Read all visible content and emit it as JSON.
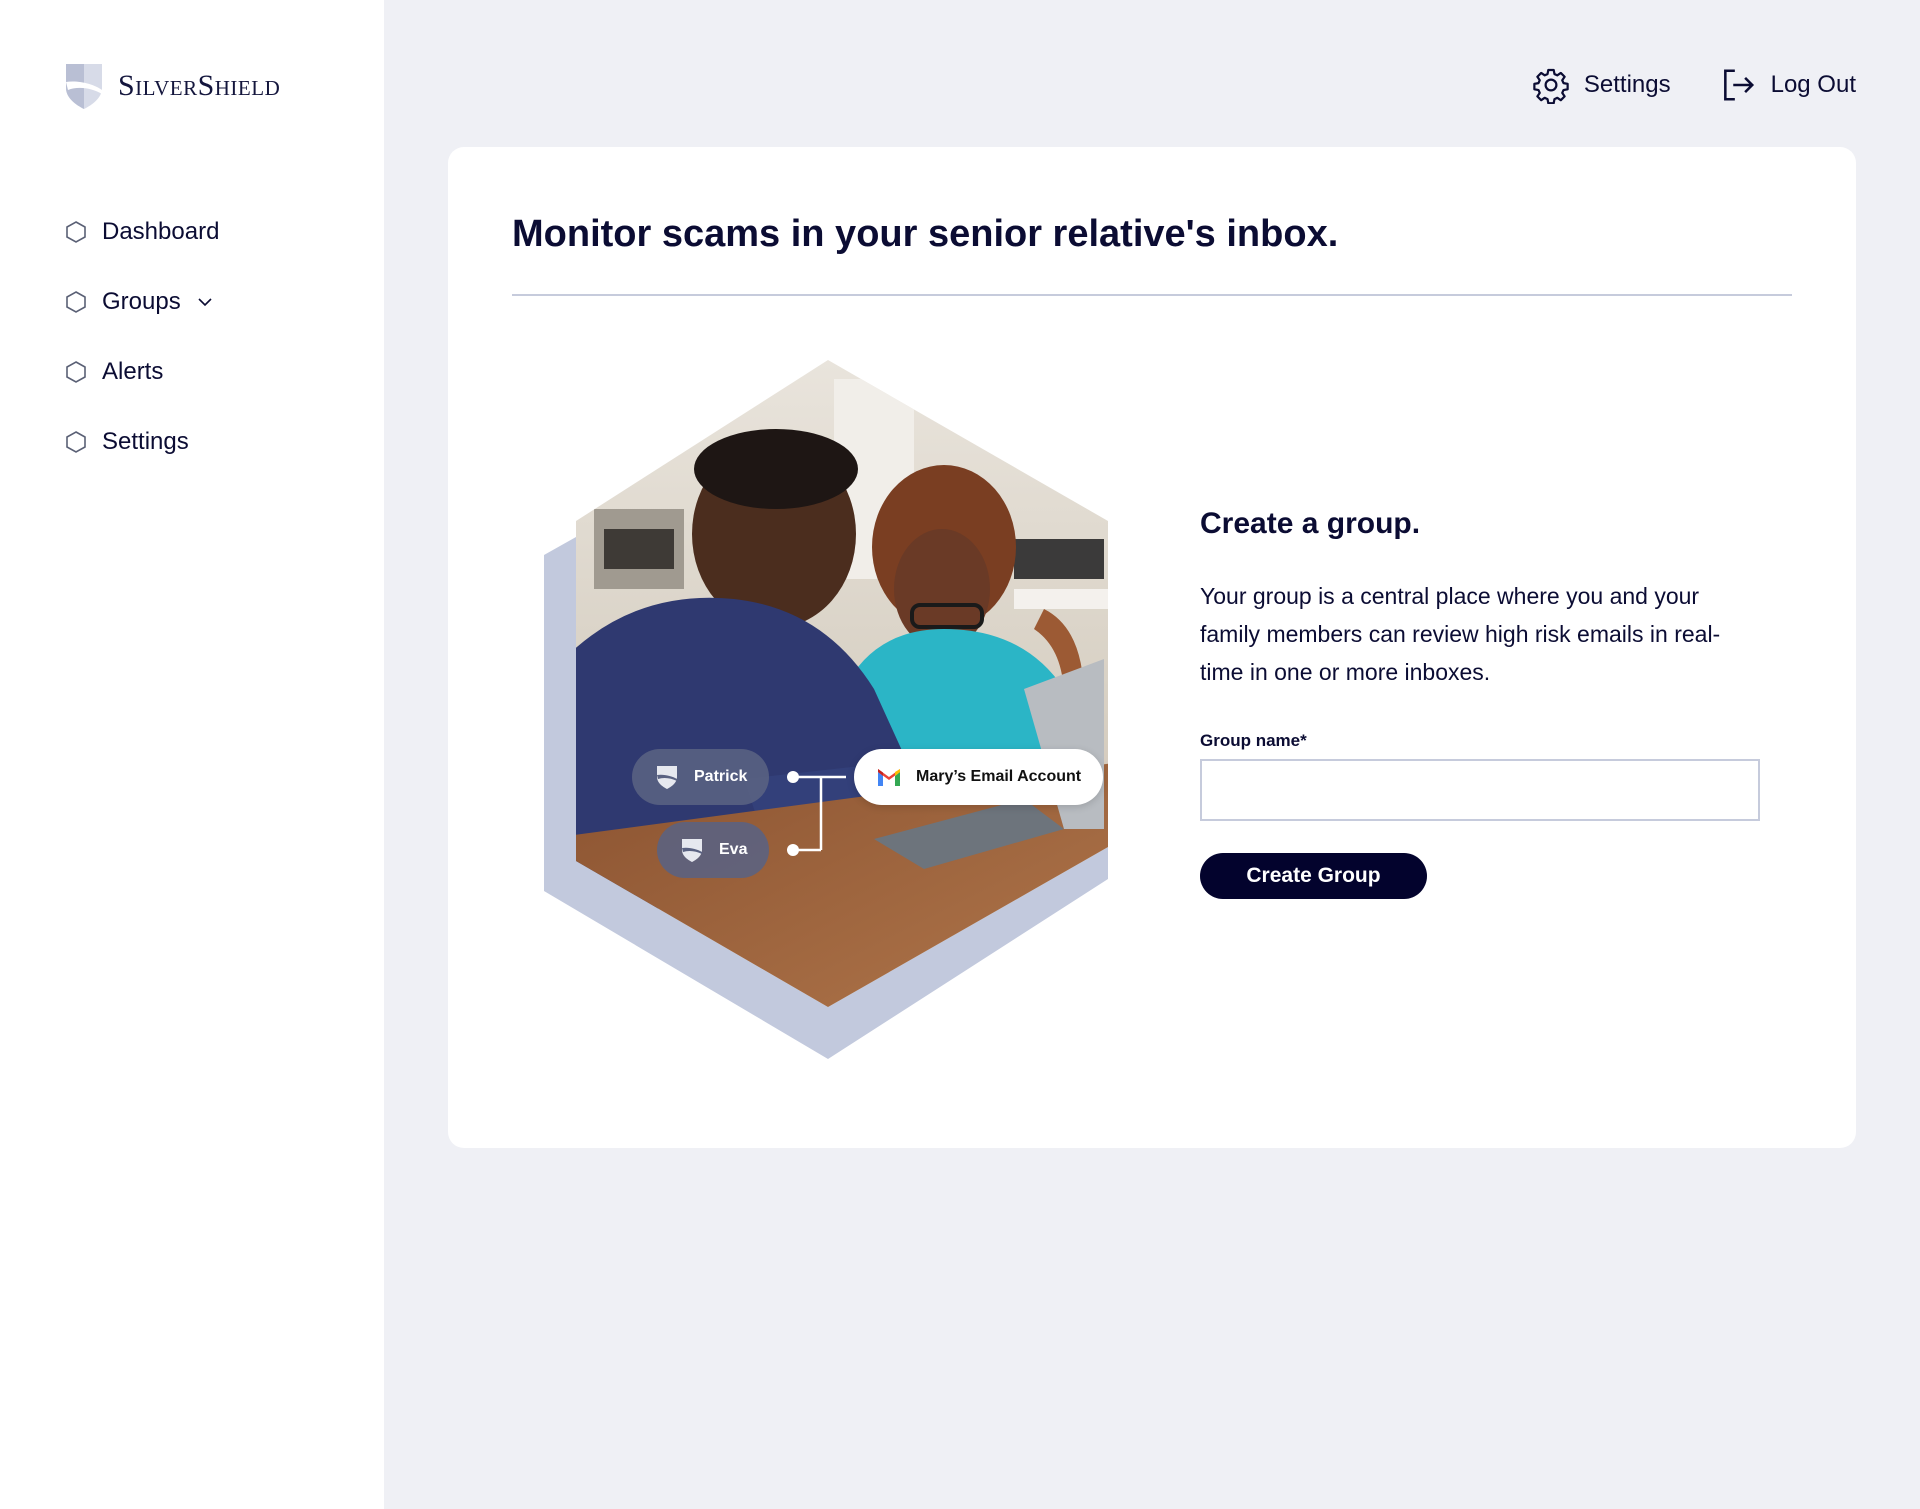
{
  "brand": {
    "name": "SilverShield"
  },
  "sidebar": {
    "items": [
      {
        "label": "Dashboard",
        "icon": "hexagon-icon"
      },
      {
        "label": "Groups",
        "icon": "hexagon-icon",
        "expandable": true
      },
      {
        "label": "Alerts",
        "icon": "hexagon-icon"
      },
      {
        "label": "Settings",
        "icon": "hexagon-icon"
      }
    ]
  },
  "topbar": {
    "settings_label": "Settings",
    "logout_label": "Log Out"
  },
  "main": {
    "title": "Monitor scams in your senior relative's inbox.",
    "illustration": {
      "members": [
        "Patrick",
        "Eva"
      ],
      "account_label": "Mary’s Email Account"
    },
    "form": {
      "heading": "Create a group.",
      "description": "Your group is a central place where you and your family members can review high risk emails in real-time in one or more inboxes.",
      "group_name_label": "Group name*",
      "group_name_value": "",
      "group_name_placeholder": "",
      "submit_label": "Create Group"
    }
  },
  "colors": {
    "primary": "#03032d",
    "text": "#0b0c33",
    "background": "#eff0f5",
    "accent_hex": "#c2c9dd"
  }
}
